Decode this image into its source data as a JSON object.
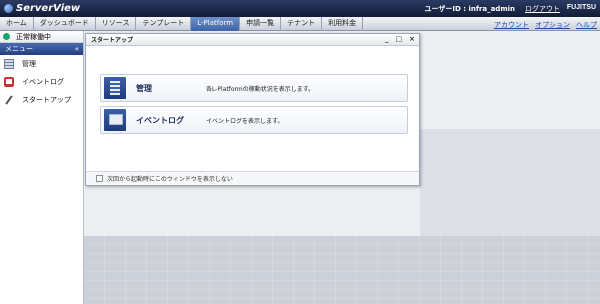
{
  "header": {
    "app_name": "ServerView",
    "user_label": "ユーザーID : infra_admin",
    "logout": "ログアウト",
    "brand": "FUJITSU"
  },
  "tabs": [
    {
      "label": "ホーム"
    },
    {
      "label": "ダッシュボード"
    },
    {
      "label": "リソース"
    },
    {
      "label": "テンプレート"
    },
    {
      "label": "L-Platform",
      "active": true
    },
    {
      "label": "申請一覧"
    },
    {
      "label": "テナント"
    },
    {
      "label": "利用料金"
    }
  ],
  "tab_links": [
    "アカウント",
    "オプション",
    "ヘルプ"
  ],
  "sidebar": {
    "status": "正常稼働中",
    "menu_title": "メニュー",
    "collapse": "«",
    "items": [
      {
        "label": "管理",
        "icon": "server-icon"
      },
      {
        "label": "イベントログ",
        "icon": "event-log-icon"
      },
      {
        "label": "スタートアップ",
        "icon": "startup-icon"
      }
    ]
  },
  "startup_window": {
    "title": "スタートアップ",
    "controls": [
      "_",
      "□",
      "×"
    ],
    "cards": [
      {
        "title": "管理",
        "desc": "各L-Platformの稼動状況を表示します。"
      },
      {
        "title": "イベントログ",
        "desc": "イベントログを表示します。"
      }
    ],
    "footer_checkbox": "次回から起動時にこのウィンドウを表示しない"
  },
  "colors": {
    "header_bg": "#1a2746",
    "active_tab": "#3e64a8",
    "status_ok": "#1aa86a"
  }
}
